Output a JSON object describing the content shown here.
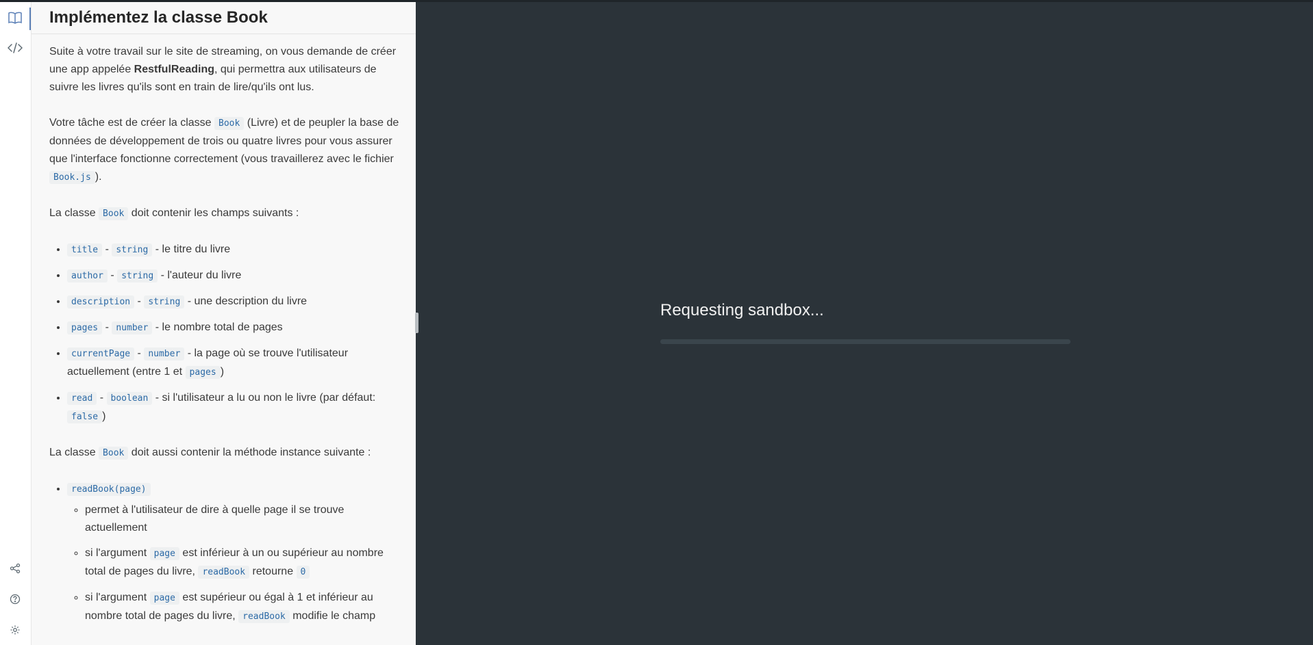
{
  "sidebar": {
    "icons": [
      "book-icon",
      "code-icon",
      "share-icon",
      "help-icon",
      "settings-icon"
    ]
  },
  "panel": {
    "title": "Implémentez la classe Book",
    "intro": {
      "p1_a": "Suite à votre travail sur le site de streaming, on vous demande de créer une app appelée ",
      "p1_bold": "RestfulReading",
      "p1_b": ", qui permettra aux utilisateurs de suivre les livres qu'ils sont en train de lire/qu'ils ont lus.",
      "p2_a": "Votre tâche est de créer la classe ",
      "p2_code1": "Book",
      "p2_b": " (Livre) et de peupler la base de données de développement de trois ou quatre livres pour vous assurer que l'interface fonctionne correctement (vous travaillerez avec le fichier ",
      "p2_code2": "Book.js",
      "p2_c": ").",
      "p3_a": "La classe ",
      "p3_code": "Book",
      "p3_b": " doit contenir les champs suivants :"
    },
    "fields": [
      {
        "name": "title",
        "type": "string",
        "desc": " - le titre du livre"
      },
      {
        "name": "author",
        "type": "string",
        "desc": " - l'auteur du livre"
      },
      {
        "name": "description",
        "type": "string",
        "desc": " - une description du livre"
      },
      {
        "name": "pages",
        "type": "number",
        "desc": " - le nombre total de pages"
      },
      {
        "name": "currentPage",
        "type": "number",
        "desc": " - la page où se trouve l'utilisateur actuellement (entre 1 et ",
        "code2": "pages",
        "desc2": ")"
      },
      {
        "name": "read",
        "type": "boolean",
        "desc": " - si l'utilisateur a lu ou non le livre (par défaut: ",
        "code2": "false",
        "desc2": ")"
      }
    ],
    "method_intro": {
      "a": "La classe ",
      "code": "Book",
      "b": " doit aussi contenir la méthode instance suivante :"
    },
    "method": {
      "signature": "readBook(page)",
      "bullet1": "permet à l'utilisateur de dire à quelle page il se trouve actuellement",
      "bullet2_a": "si l'argument ",
      "bullet2_code1": "page",
      "bullet2_b": " est inférieur à un ou supérieur au nombre total de pages du livre, ",
      "bullet2_code2": "readBook",
      "bullet2_c": " retourne ",
      "bullet2_code3": "0",
      "bullet3_a": "si l'argument ",
      "bullet3_code1": "page",
      "bullet3_b": " est supérieur ou égal à 1 et inférieur au nombre total de pages du livre, ",
      "bullet3_code2": "readBook",
      "bullet3_c": " modifie le champ"
    }
  },
  "main": {
    "loading_text": "Requesting sandbox...",
    "progress_fraction": 0,
    "colors": {
      "background": "#2b3339",
      "progress_track": "#3a454c",
      "code_text": "#2c6aa6"
    }
  }
}
